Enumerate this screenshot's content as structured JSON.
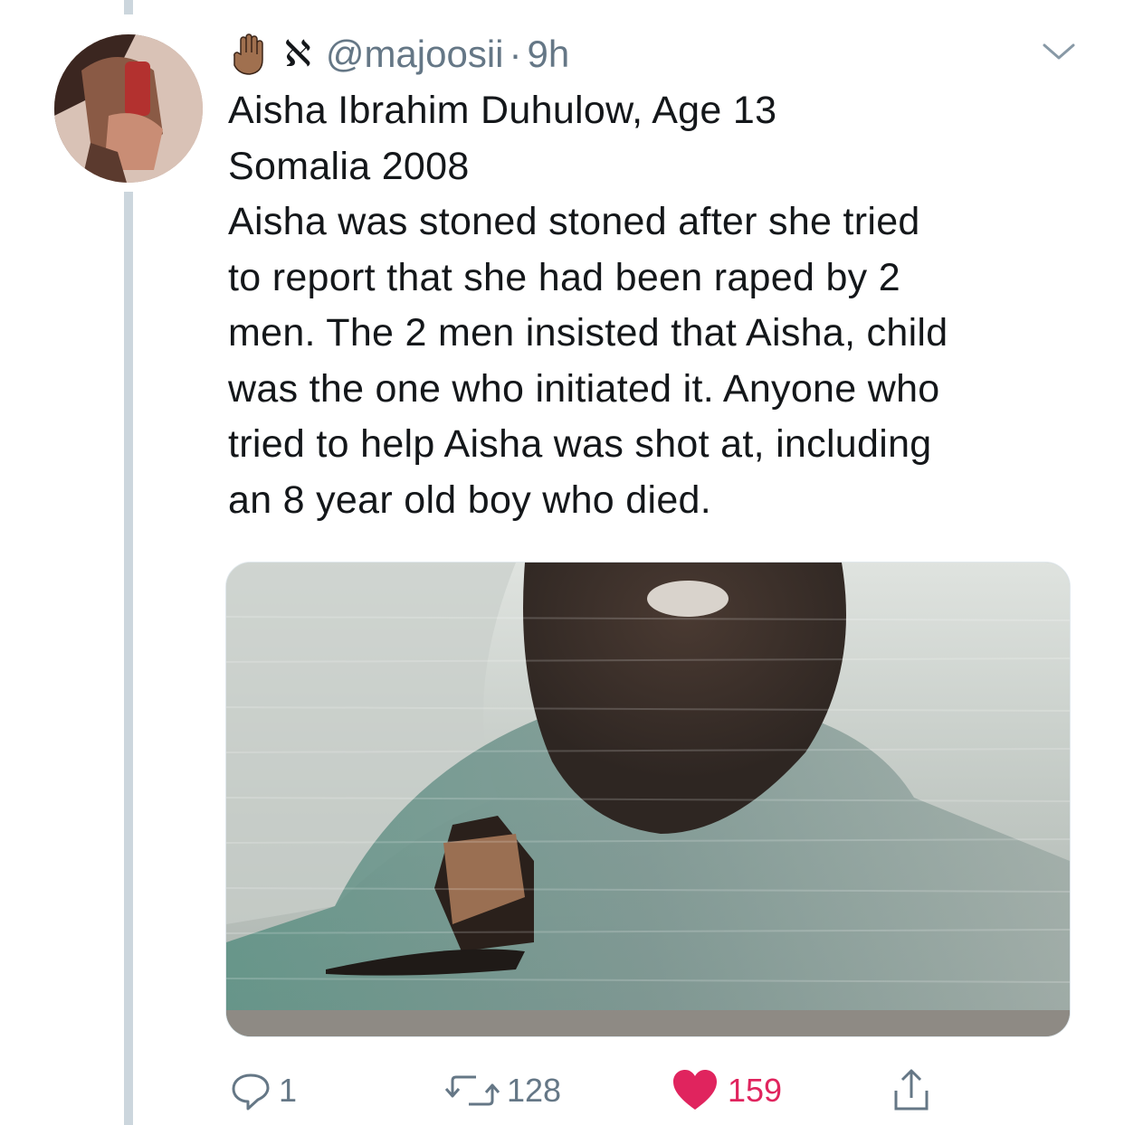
{
  "tweet": {
    "display_name_emoji": "raised-hand-icon",
    "display_name_glyph": "ℵ",
    "handle": "@majoosii",
    "separator": "·",
    "time": "9h",
    "text_lines": [
      "Aisha Ibrahim Duhulow, Age 13",
      "Somalia 2008",
      "Aisha was stoned stoned after she tried",
      "to report that she had been raped by 2",
      "men. The 2 men insisted that Aisha, child",
      "was the one who initiated it. Anyone who",
      "tried to help Aisha was shot at, including",
      "an 8 year old boy who died."
    ],
    "media_icon": "photo-attachment",
    "actions": {
      "reply_count": "1",
      "retweet_count": "128",
      "like_count": "159"
    }
  },
  "colors": {
    "text": "#14171a",
    "secondary": "#657786",
    "like": "#e0245e",
    "thread_line": "#ccd6dd"
  }
}
